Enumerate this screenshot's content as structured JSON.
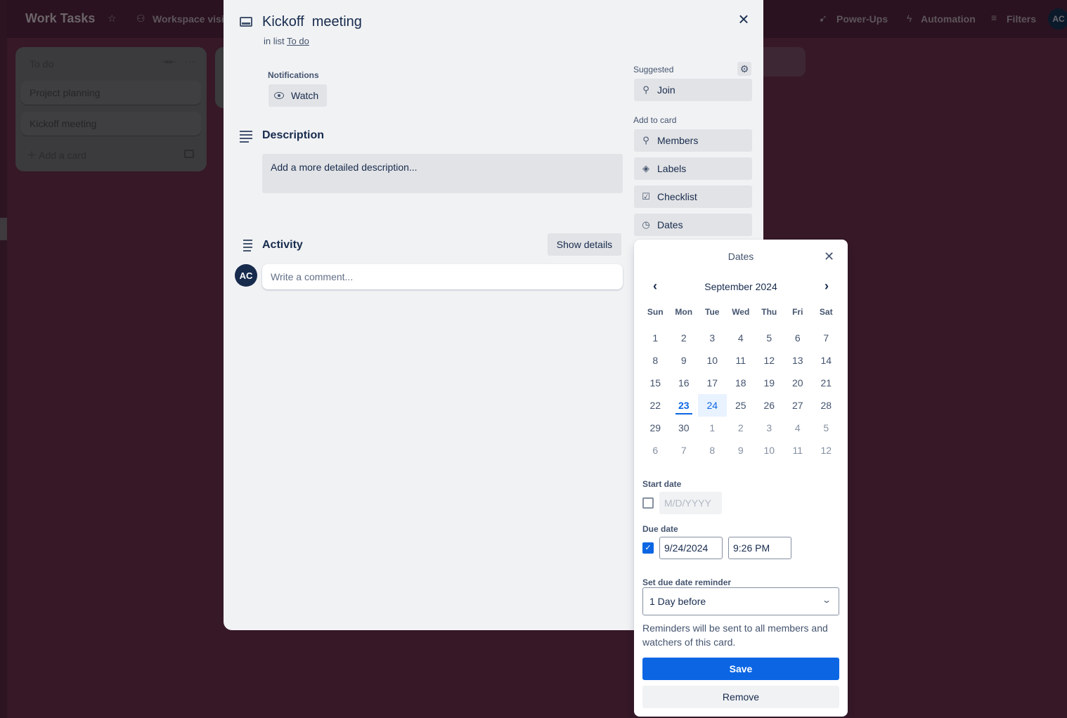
{
  "board": {
    "title": "Work Tasks",
    "visibility_label": "Workspace visib",
    "topbar_right": {
      "powerups": "Power-Ups",
      "automation": "Automation",
      "filters": "Filters",
      "avatar_initials": "AC"
    },
    "list": {
      "title": "To do",
      "cards": [
        "Project planning",
        "Kickoff meeting"
      ],
      "add_card": "Add a card"
    }
  },
  "card_modal": {
    "title": "Kickoff  meeting",
    "in_list_prefix": "in list",
    "list_name": "To do",
    "notifications_label": "Notifications",
    "watch_label": "Watch",
    "description": {
      "title": "Description",
      "placeholder": "Add a more detailed description..."
    },
    "activity": {
      "title": "Activity",
      "show_details": "Show details",
      "avatar_initials": "AC",
      "comment_placeholder": "Write a comment..."
    },
    "sidebar": {
      "suggested_label": "Suggested",
      "join": "Join",
      "add_to_card_label": "Add to card",
      "items": [
        {
          "label": "Members",
          "icon": "person-icon"
        },
        {
          "label": "Labels",
          "icon": "tag-icon"
        },
        {
          "label": "Checklist",
          "icon": "checklist-icon"
        },
        {
          "label": "Dates",
          "icon": "clock-icon"
        }
      ]
    }
  },
  "dates_popover": {
    "title": "Dates",
    "month_label": "September 2024",
    "weekdays": [
      "Sun",
      "Mon",
      "Tue",
      "Wed",
      "Thu",
      "Fri",
      "Sat"
    ],
    "weeks": [
      [
        1,
        2,
        3,
        4,
        5,
        6,
        7
      ],
      [
        8,
        9,
        10,
        11,
        12,
        13,
        14
      ],
      [
        15,
        16,
        17,
        18,
        19,
        20,
        21
      ],
      [
        22,
        23,
        24,
        25,
        26,
        27,
        28
      ],
      [
        29,
        30,
        1,
        2,
        3,
        4,
        5
      ],
      [
        6,
        7,
        8,
        9,
        10,
        11,
        12
      ]
    ],
    "today": 23,
    "selected": 24,
    "start_date": {
      "label": "Start date",
      "checked": false,
      "placeholder": "M/D/YYYY"
    },
    "due_date": {
      "label": "Due date",
      "checked": true,
      "date": "9/24/2024",
      "time": "9:26 PM"
    },
    "reminder": {
      "label": "Set due date reminder",
      "value": "1 Day before"
    },
    "hint": "Reminders will be sent to all members and watchers of this card.",
    "save": "Save",
    "remove": "Remove",
    "accent_color": "#0c66e4"
  }
}
